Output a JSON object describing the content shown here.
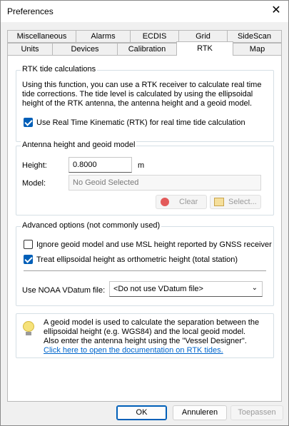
{
  "window": {
    "title": "Preferences"
  },
  "tabs_row1": [
    "Miscellaneous",
    "Alarms",
    "ECDIS",
    "Grid",
    "SideScan"
  ],
  "tabs_row2": [
    "Units",
    "Devices",
    "Calibration",
    "RTK",
    "Map"
  ],
  "active_tab": "RTK",
  "rtk": {
    "title": "RTK tide calculations",
    "description_lines": [
      "Using this function, you can use a RTK receiver to calculate real time",
      "tide corrections. The tide level is calculated by using the ellipsoidal",
      "height of the RTK antenna, the antenna height and a geoid model."
    ],
    "use_rtk_label": "Use Real Time Kinematic (RTK) for real time tide calculation",
    "use_rtk_checked": true
  },
  "antenna": {
    "title": "Antenna height and geoid model",
    "height_label": "Height:",
    "height_value": "0.8000",
    "height_unit": "m",
    "model_label": "Model:",
    "model_value": "No Geoid Selected",
    "clear_label": "Clear",
    "select_label": "Select..."
  },
  "advanced": {
    "title": "Advanced options (not commonly used)",
    "ignore_geoid_label": "Ignore geoid model and use MSL height reported by GNSS receiver",
    "ignore_geoid_checked": false,
    "treat_ellipsoidal_label": "Treat ellipsoidal height as orthometric height (total station)",
    "treat_ellipsoidal_checked": true,
    "vdatum_label": "Use NOAA VDatum file:",
    "vdatum_value": "<Do not use VDatum file>"
  },
  "info": {
    "lines": [
      "A geoid model is used to calculate the separation between the",
      "ellipsoidal height (e.g. WGS84) and the local geoid model.",
      "Also enter the antenna height using the \"Vessel Designer\"."
    ],
    "link_text": "Click here to open the documentation on RTK tides."
  },
  "footer": {
    "ok": "OK",
    "cancel": "Annuleren",
    "apply": "Toepassen"
  },
  "colors": {
    "accent": "#005fb8",
    "link": "#0066cc"
  }
}
